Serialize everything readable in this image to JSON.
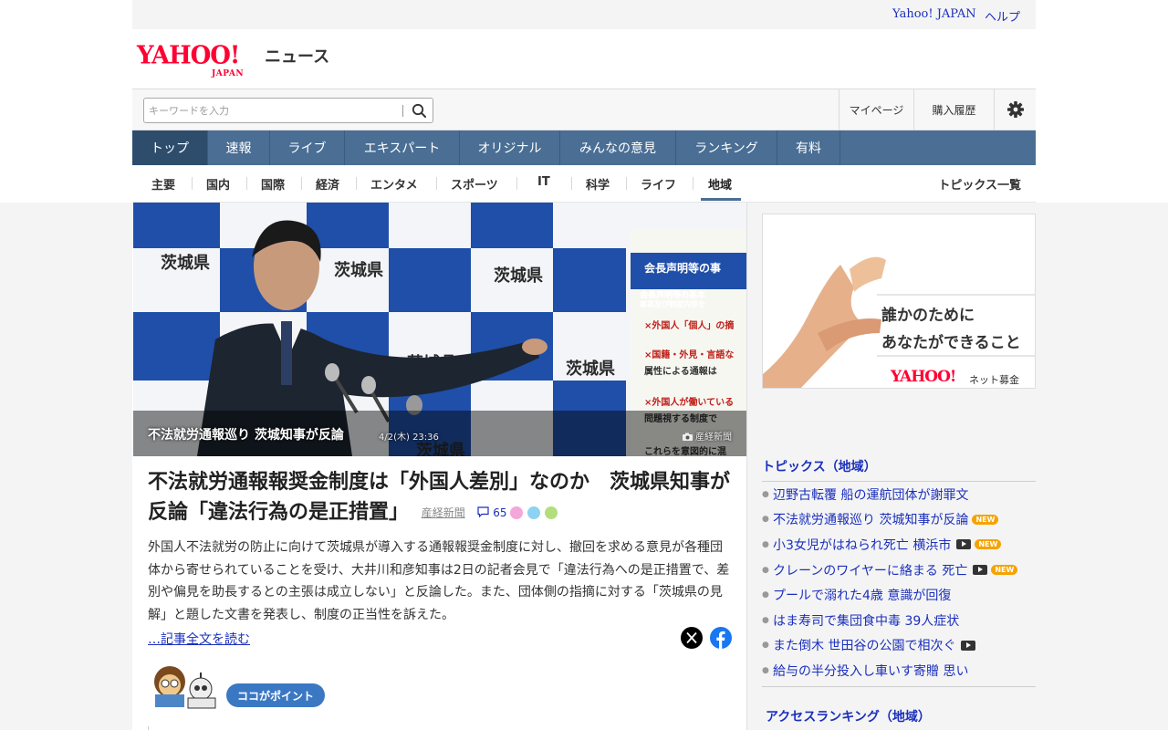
{
  "util": {
    "yahoo_japan": "Yahoo! JAPAN",
    "help": "ヘルプ"
  },
  "logo": {
    "yahoo": "YAHOO!",
    "japan": "JAPAN",
    "news": "ニュース"
  },
  "search": {
    "placeholder": "キーワードを入力"
  },
  "header_links": {
    "mypage": "マイページ",
    "purchase": "購入履歴"
  },
  "nav": [
    "トップ",
    "速報",
    "ライブ",
    "エキスパート",
    "オリジナル",
    "みんなの意見",
    "ランキング",
    "有料"
  ],
  "categories": [
    "主要",
    "国内",
    "国際",
    "経済",
    "エンタメ",
    "スポーツ",
    "IT",
    "科学",
    "ライフ",
    "地域"
  ],
  "active_category": "地域",
  "topics_all": "トピックス一覧",
  "photo": {
    "caption": "不法就労通報巡り 茨城知事が反論",
    "date": "4/2(木) 23:36",
    "source": "産経新聞",
    "backdrop_text": [
      "茨城県",
      "茨城県",
      "茨城県",
      "茨城県",
      "茨城県",
      "茨城県"
    ],
    "panel_text": [
      "会長声明等の事",
      "会長声明等の基本",
      "事実及び制度内容を",
      "×外国人「個人」の摘",
      "×国籍・外見・言語な",
      "属性による通報は",
      "×外国人が働いている",
      "問題視する制度で",
      "これらを意図的に混"
    ]
  },
  "article": {
    "headline": "不法就労通報報奨金制度は「外国人差別」なのか　茨城県知事が反論「違法行為の是正措置」",
    "source": "産経新聞",
    "comments": "65",
    "summary": "外国人不法就労の防止に向けて茨城県が導入する通報報奨金制度に対し、撤回を求める意見が各種団体から寄せられていることを受け、大井川和彦知事は2日の記者会見で「違法行為への是正措置で、差別や偏見を助長するとの主張は成立しない」と反論した。また、団体側の指摘に対する「茨城県の見解」と題した文書を発表し、制度の正当性を訴えた。",
    "read_more": "…記事全文を読む",
    "point_badge": "ココがポイント"
  },
  "ad": {
    "line1": "誰かのために",
    "line2": "あなたができること",
    "brand": "YAHOO!",
    "brand_sub": "JAPAN",
    "service": "ネット募金"
  },
  "topics_section": {
    "title": "トピックス（地域）",
    "items": [
      {
        "text": "辺野古転覆 船の運航団体が謝罪文",
        "video": false,
        "new": false
      },
      {
        "text": "不法就労通報巡り 茨城知事が反論",
        "video": false,
        "new": true
      },
      {
        "text": "小3女児がはねられ死亡 横浜市",
        "video": true,
        "new": true
      },
      {
        "text": "クレーンのワイヤーに絡まる 死亡",
        "video": true,
        "new": true
      },
      {
        "text": "プールで溺れた4歳 意識が回復",
        "video": false,
        "new": false
      },
      {
        "text": "はま寿司で集団食中毒 39人症状",
        "video": false,
        "new": false
      },
      {
        "text": "また倒木 世田谷の公園で相次ぐ",
        "video": true,
        "new": false
      },
      {
        "text": "給与の半分投入し車いす寄贈 思い",
        "video": false,
        "new": false
      }
    ],
    "new_label": "NEW"
  },
  "access_ranking": {
    "title": "アクセスランキング（地域）"
  },
  "colors": {
    "nav": "#4a6e94",
    "nav_active": "#2e4d6d",
    "link": "#1a2fbd",
    "brand_red": "#ff0033",
    "new_badge": "#f5a300"
  }
}
